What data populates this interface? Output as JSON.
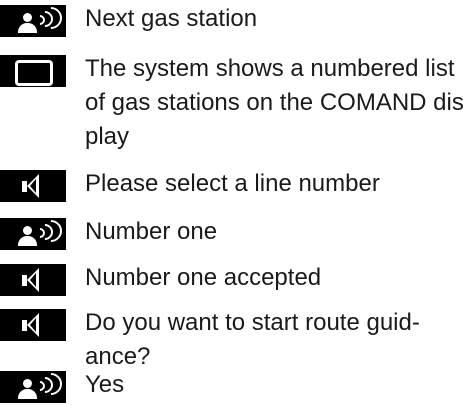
{
  "dialog": {
    "steps": [
      {
        "speaker": "user",
        "icon": "speech-input-icon",
        "text": [
          "Next gas station"
        ]
      },
      {
        "speaker": "display",
        "icon": "display-icon",
        "text": [
          "The system shows a numbered list",
          "of gas stations on the COMAND dis-",
          "play"
        ]
      },
      {
        "speaker": "system",
        "icon": "voice-output-icon",
        "text": [
          "Please select a line number"
        ]
      },
      {
        "speaker": "user",
        "icon": "speech-input-icon",
        "text": [
          "Number one"
        ]
      },
      {
        "speaker": "system",
        "icon": "voice-output-icon",
        "text": [
          "Number one accepted"
        ]
      },
      {
        "speaker": "system",
        "icon": "voice-output-icon",
        "text": [
          "Do you want to start route guid-",
          "ance?"
        ]
      },
      {
        "speaker": "user",
        "icon": "speech-input-icon",
        "text": [
          "Yes"
        ]
      }
    ]
  }
}
